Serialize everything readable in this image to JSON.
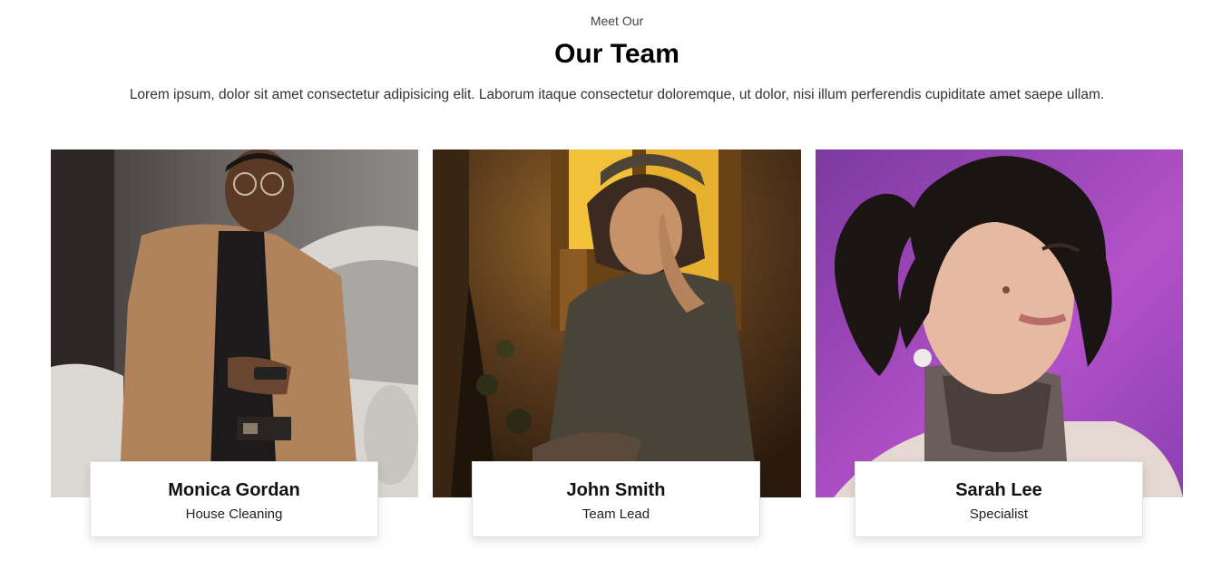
{
  "header": {
    "eyebrow": "Meet Our",
    "title": "Our Team",
    "subtitle": "Lorem ipsum, dolor sit amet consectetur adipisicing elit. Laborum itaque consectetur doloremque, ut dolor, nisi illum perferendis cupiditate amet saepe ullam."
  },
  "team": [
    {
      "name": "Monica Gordan",
      "role": "House Cleaning"
    },
    {
      "name": "John Smith",
      "role": "Team Lead"
    },
    {
      "name": "Sarah Lee",
      "role": "Specialist"
    }
  ]
}
